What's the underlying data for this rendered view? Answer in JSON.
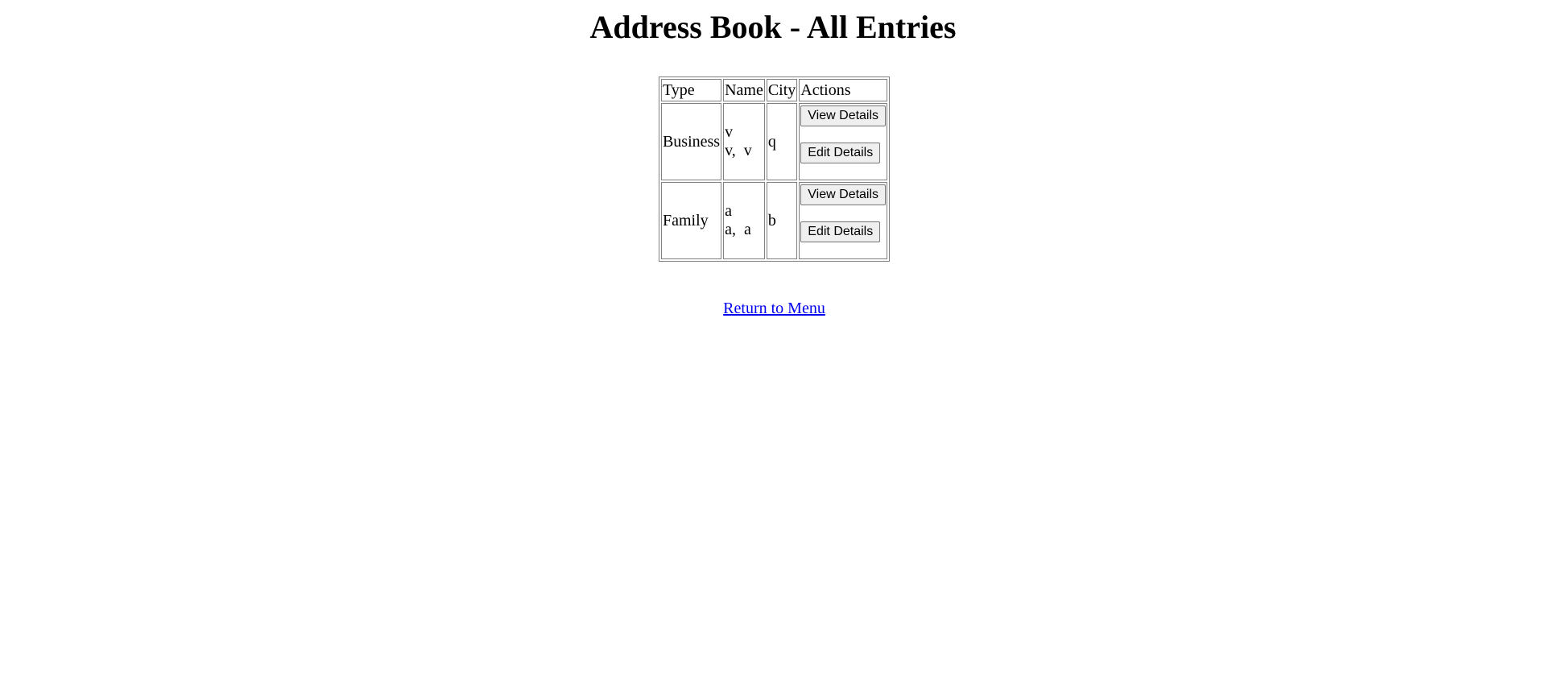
{
  "page": {
    "title": "Address Book - All Entries"
  },
  "table": {
    "headers": [
      "Type",
      "Name",
      "City",
      "Actions"
    ],
    "rows": [
      {
        "type": "Business",
        "name_line1": "v",
        "name_line2": "v,  v",
        "city": "q",
        "view_label": "View Details",
        "edit_label": "Edit Details"
      },
      {
        "type": "Family",
        "name_line1": "a",
        "name_line2": "a,  a",
        "city": "b",
        "view_label": "View Details",
        "edit_label": "Edit Details"
      }
    ]
  },
  "footer": {
    "return_link": "Return to Menu"
  },
  "colors": {
    "link": "#0000ee",
    "border": "#808080",
    "button_bg": "#efefef"
  }
}
